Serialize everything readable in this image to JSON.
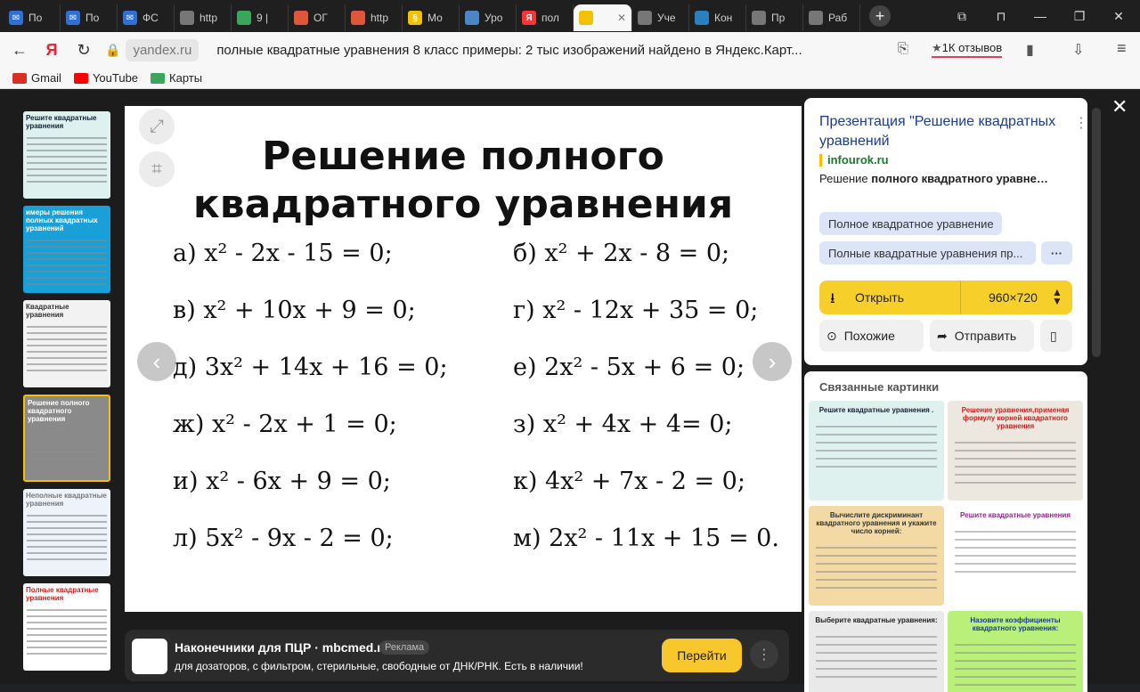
{
  "tabs": [
    {
      "label": "По",
      "color": "#2f6fd6",
      "glyph": "✉"
    },
    {
      "label": "По",
      "color": "#2f6fd6",
      "glyph": "✉"
    },
    {
      "label": "ФС",
      "color": "#2f6fd6",
      "glyph": "✉"
    },
    {
      "label": "http",
      "color": "#777777",
      "glyph": ""
    },
    {
      "label": "9 |",
      "color": "#3aa65b",
      "glyph": ""
    },
    {
      "label": "ОГ",
      "color": "#e0563a",
      "glyph": ""
    },
    {
      "label": "http",
      "color": "#e0563a",
      "glyph": ""
    },
    {
      "label": "Мо",
      "color": "#f2c200",
      "glyph": "§"
    },
    {
      "label": "Уро",
      "color": "#4a86c5",
      "glyph": ""
    },
    {
      "label": "пол",
      "color": "#ff3333",
      "glyph": "Я"
    },
    {
      "label": "",
      "color": "#f2c200",
      "glyph": "",
      "active": true
    },
    {
      "label": "Уче",
      "color": "#777777",
      "glyph": ""
    },
    {
      "label": "Кон",
      "color": "#2a7fc1",
      "glyph": ""
    },
    {
      "label": "Пр",
      "color": "#777777",
      "glyph": ""
    },
    {
      "label": "Раб",
      "color": "#777777",
      "glyph": ""
    }
  ],
  "address": {
    "domain": "yandex.ru",
    "title": "полные квадратные уравнения 8 класс примеры: 2 тыс изображений найдено в Яндекс.Карт...",
    "reviews": "1К отзывов"
  },
  "bookmarks": [
    {
      "label": "Gmail",
      "color": "#d93025"
    },
    {
      "label": "YouTube",
      "color": "#ff0000"
    },
    {
      "label": "Карты",
      "color": "#3aa65b"
    }
  ],
  "slide": {
    "title_line1": "Решение полного",
    "title_line2": "квадратного уравнения",
    "equations_left": [
      "а)  x² - 2x - 15 = 0;",
      "в)  x² + 10x + 9 = 0;",
      "д)  3x² + 14x + 16 = 0;",
      "ж)  x² - 2x + 1 = 0;",
      "и)  x² - 6x + 9 = 0;",
      "л) 5x² - 9x - 2 = 0;"
    ],
    "equations_right": [
      "б) x² + 2x - 8 = 0;",
      "г) x² - 12x + 35 = 0;",
      "е) 2x² - 5x + 6 = 0;",
      "з) x² + 4x + 4= 0;",
      "к) 4x² + 7x - 2 = 0;",
      "м) 2x² - 11x + 15 = 0."
    ]
  },
  "thumbnails": [
    {
      "title": "Решите квадратные уравнения",
      "bg": "#dff1ef",
      "fg": "#123"
    },
    {
      "title": "имеры решения полных квадратных уравнений",
      "bg": "#1aa0d8",
      "fg": "#ffffff"
    },
    {
      "title": "Квадратные уравнения",
      "bg": "#f2f2f2",
      "fg": "#333"
    },
    {
      "title": "Решение полного квадратного уравнения",
      "bg": "#8a8a8a",
      "fg": "#ffffff"
    },
    {
      "title": "Неполные квадратные уравнения",
      "bg": "#eef3fb",
      "fg": "#777"
    },
    {
      "title": "Полные квадратные уравнения",
      "bg": "#ffffff",
      "fg": "#c22"
    }
  ],
  "ad": {
    "title": "Наконечники для ПЦР · mbcmed.ru",
    "tag": "Реклама",
    "desc": "для дозаторов, с фильтром, стерильные, свободные от ДНК/РНК. Есть в наличии!",
    "button": "Перейти"
  },
  "panel": {
    "title": "Презентация \"Решение квадратных уравнений",
    "site": "infourok.ru",
    "desc_plain": "Решение ",
    "desc_bold": "полного квадратного уравне…",
    "chips": [
      "Полное квадратное уравнение",
      "Полные квадратные уравнения пр..."
    ],
    "open_label": "Открыть",
    "size": "960×720",
    "similar": "Похожие",
    "share": "Отправить"
  },
  "related": {
    "title": "Связанные картинки",
    "items": [
      {
        "title": "Решите квадратные уравнения .",
        "bg": "#dff1ef",
        "fg": "#123"
      },
      {
        "title": "Решение уравнения,применяя формулу корней квадратного уравнения",
        "bg": "#ece8df",
        "fg": "#c22"
      },
      {
        "title": "Вычислите дискриминант квадратного уравнения и укажите число корней:",
        "bg": "#f3d9a3",
        "fg": "#333"
      },
      {
        "title": "Решите квадратные уравнения",
        "bg": "#ffffff",
        "fg": "#92278f"
      },
      {
        "title": "Выберите квадратные уравнения:",
        "bg": "#e9e9e9",
        "fg": "#222"
      },
      {
        "title": "Назовите коэффициенты квадратного уравнения:",
        "bg": "#b8f07a",
        "fg": "#1a3d8f"
      }
    ]
  }
}
